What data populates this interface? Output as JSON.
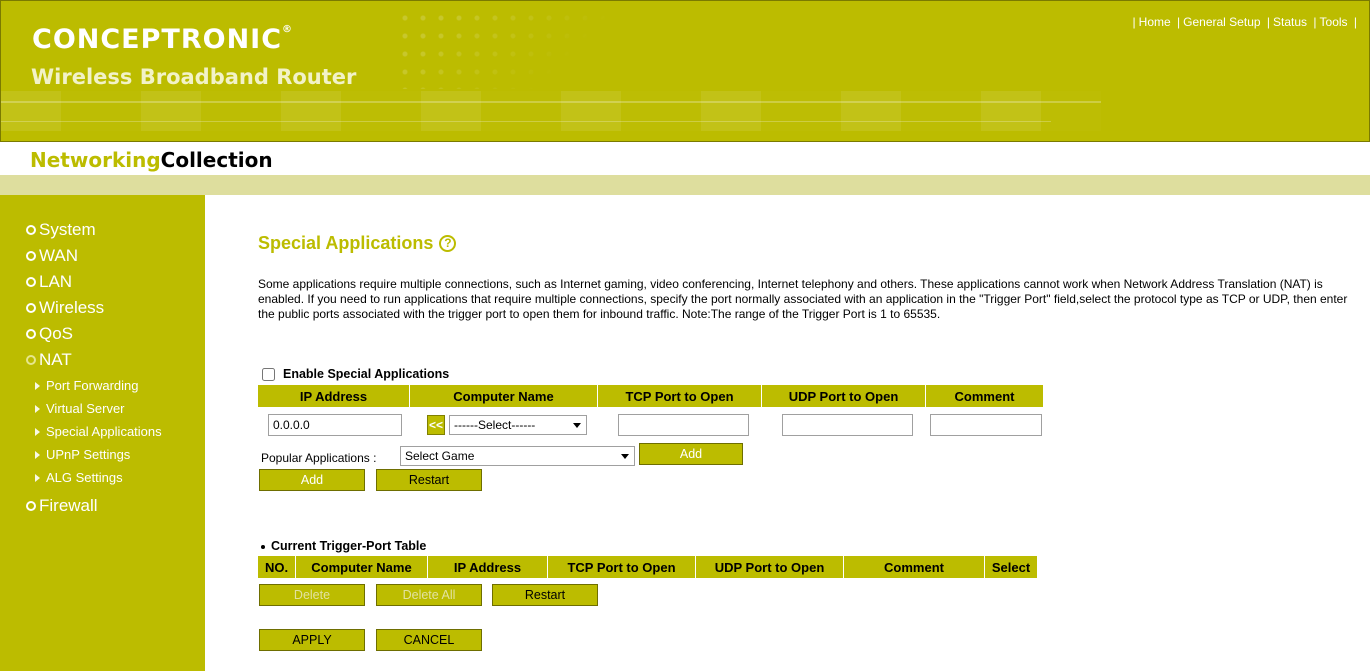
{
  "header": {
    "brand": "CONCEPTRONIC",
    "brand_mark": "®",
    "product": "Wireless Broadband Router",
    "nav": [
      "Home",
      "General Setup",
      "Status",
      "Tools"
    ]
  },
  "collection": {
    "part1": "Networking",
    "part2": "Collection"
  },
  "sidebar": {
    "items": [
      {
        "label": "System"
      },
      {
        "label": "WAN"
      },
      {
        "label": "LAN"
      },
      {
        "label": "Wireless"
      },
      {
        "label": "QoS"
      },
      {
        "label": "NAT",
        "sub": [
          "Port Forwarding",
          "Virtual Server",
          "Special Applications",
          "UPnP Settings",
          "ALG Settings"
        ]
      },
      {
        "label": "Firewall"
      }
    ]
  },
  "page": {
    "title": "Special Applications",
    "help_icon": "?",
    "description": "Some applications require multiple connections, such as Internet gaming, video conferencing, Internet telephony and others. These applications cannot work when Network Address Translation (NAT) is enabled. If you need to run applications that require multiple connections, specify the port normally associated with an application in the \"Trigger Port\" field,select the protocol type as TCP or UDP, then enter the public ports associated with the trigger port to open them for inbound traffic. Note:The range of the Trigger Port is 1 to 65535.",
    "enable_label": "Enable Special Applications",
    "form_headers": [
      "IP Address",
      "Computer Name",
      "TCP Port to Open",
      "UDP Port to Open",
      "Comment"
    ],
    "ip_value": "0.0.0.0",
    "copy_button": "<<",
    "computer_select": "------Select------",
    "popular_label": "Popular Applications :",
    "popular_select": "Select Game",
    "popular_add": "Add",
    "add_button": "Add",
    "restart_button": "Restart",
    "table_title": "Current Trigger-Port Table",
    "table_headers": [
      "NO.",
      "Computer Name",
      "IP Address",
      "TCP Port to Open",
      "UDP Port to Open",
      "Comment",
      "Select"
    ],
    "delete_button": "Delete",
    "delete_all_button": "Delete All",
    "restart2_button": "Restart",
    "apply_button": "APPLY",
    "cancel_button": "CANCEL"
  },
  "colors": {
    "accent": "#bcbc00",
    "stripe": "#dede9e"
  }
}
